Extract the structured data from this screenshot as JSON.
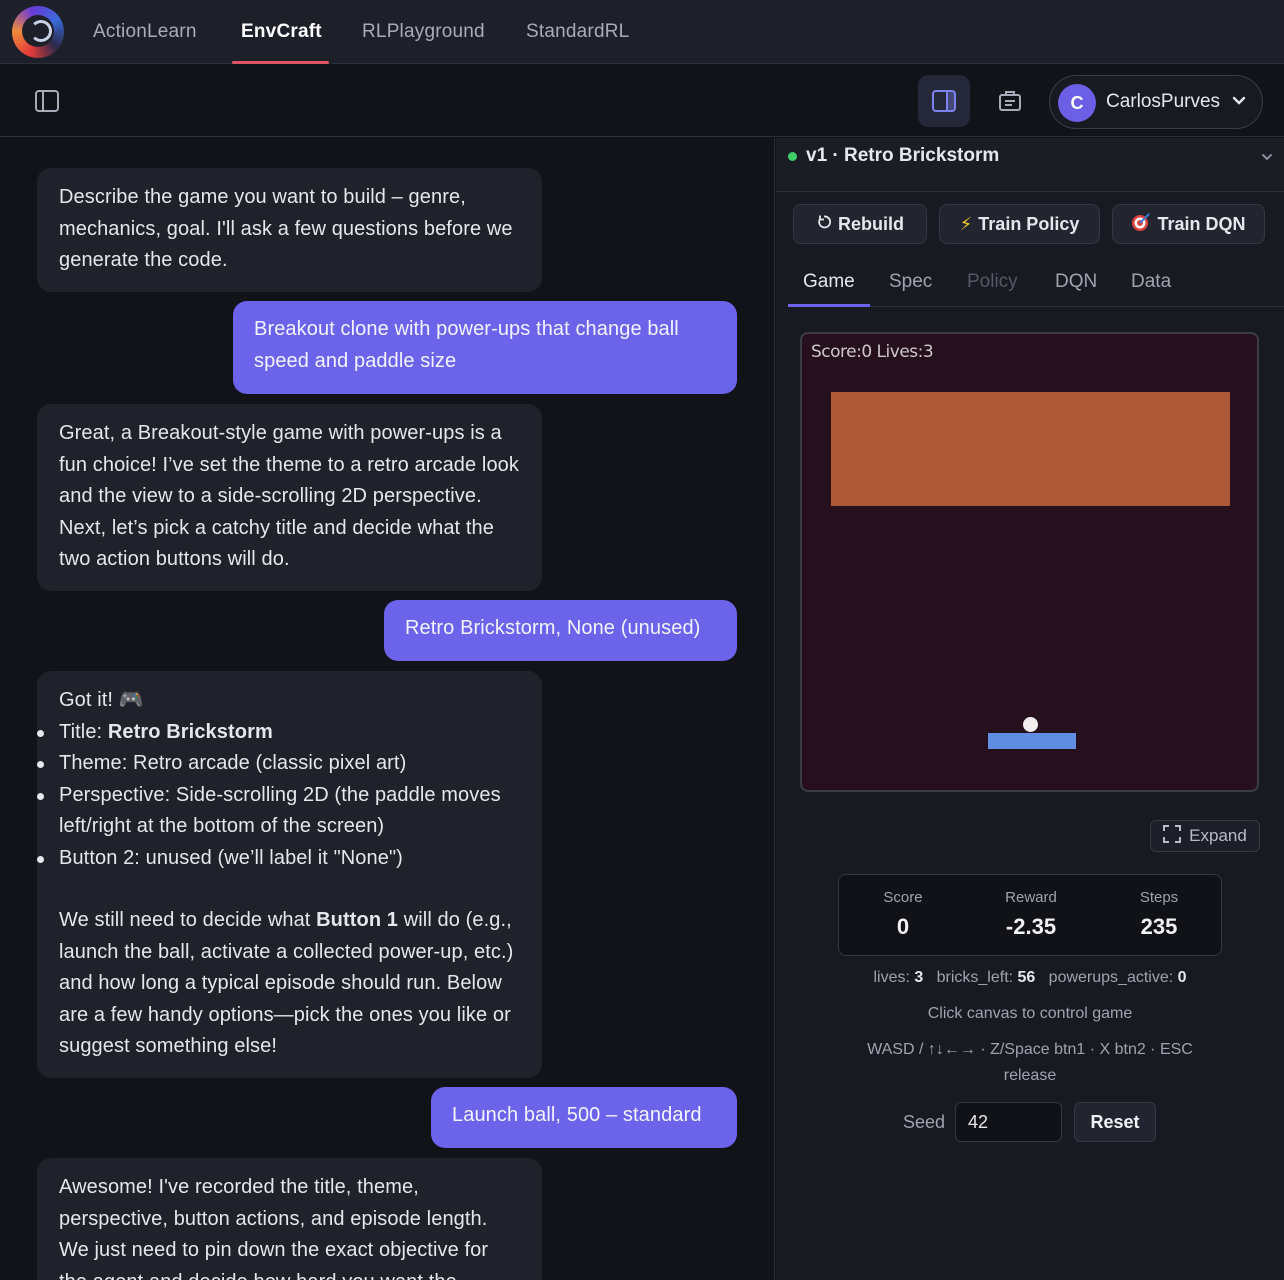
{
  "nav": {
    "tabs": [
      "ActionLearn",
      "EnvCraft",
      "RLPlayground",
      "StandardRL"
    ],
    "active_tab": "EnvCraft"
  },
  "toolbar": {
    "user": {
      "initial": "C",
      "name": "CarlosPurves"
    }
  },
  "chat": {
    "messages": [
      {
        "role": "assistant",
        "text": "Describe the game you want to build – genre, mechanics, goal. I'll ask a few questions before we generate the code."
      },
      {
        "role": "user",
        "text": "Breakout clone with power-ups that change ball speed and paddle size"
      },
      {
        "role": "assistant",
        "text": "Great, a Breakout-style game with power-ups is a fun choice! I’ve set the theme to a retro arcade look and the view to a side-scrolling 2D perspective. Next, let’s pick a catchy title and decide what the two action buttons will do."
      },
      {
        "role": "user",
        "text": "Retro Brickstorm, None (unused)"
      },
      {
        "role": "assistant",
        "intro": "Got it! 🎮",
        "bullets": [
          {
            "label": "Title: ",
            "value": "Retro Brickstorm"
          },
          {
            "label": "Theme: Retro arcade (classic pixel art)"
          },
          {
            "label": "Perspective: Side-scrolling 2D (the paddle moves left/right at the bottom of the screen)"
          },
          {
            "label": "Button 2: unused (we’ll label it \"None\")"
          }
        ],
        "p_before": "We still need to decide what ",
        "p_bold": "Button 1",
        "p_after": " will do (e.g., launch the ball, activate a collected power-up, etc.) and how long a typical episode should run. Below are a few handy options—pick the ones you like or suggest something else!"
      },
      {
        "role": "user",
        "text": "Launch ball, 500 – standard"
      },
      {
        "role": "assistant",
        "text": "Awesome! I've recorded the title, theme, perspective, button actions, and episode length. We just need to pin down the exact objective for the agent and decide how hard you want the"
      }
    ]
  },
  "panel": {
    "version_title": "v1 · Retro Brickstorm",
    "actions": {
      "rebuild": "Rebuild",
      "train_policy": "Train Policy",
      "train_dqn": "Train DQN"
    },
    "tabs": [
      "Game",
      "Spec",
      "Policy",
      "DQN",
      "Data"
    ],
    "active_tab": "Game",
    "disabled_tab": "Policy",
    "game": {
      "hud": "Score:0 Lives:3"
    },
    "expand_label": "Expand",
    "stats": [
      {
        "label": "Score",
        "value": "0"
      },
      {
        "label": "Reward",
        "value": "-2.35"
      },
      {
        "label": "Steps",
        "value": "235"
      }
    ],
    "info": {
      "lives_label": "lives:",
      "lives": "3",
      "bricks_label": "bricks_left:",
      "bricks": "56",
      "powerups_label": "powerups_active:",
      "powerups": "0"
    },
    "hint": "Click canvas to control game",
    "controls_line1": "WASD / ↑↓←→  ·  Z/Space btn1  ·  X btn2  ·  ESC",
    "controls_line2": "release",
    "seed_label": "Seed",
    "seed_value": "42",
    "reset_label": "Reset"
  },
  "colors": {
    "accent": "#6b63ea",
    "nav_underline": "#e05461",
    "status_dot": "#3ccf6a",
    "brick": "#ae5a38",
    "paddle": "#5f8de0",
    "game_bg": "#26101e"
  }
}
